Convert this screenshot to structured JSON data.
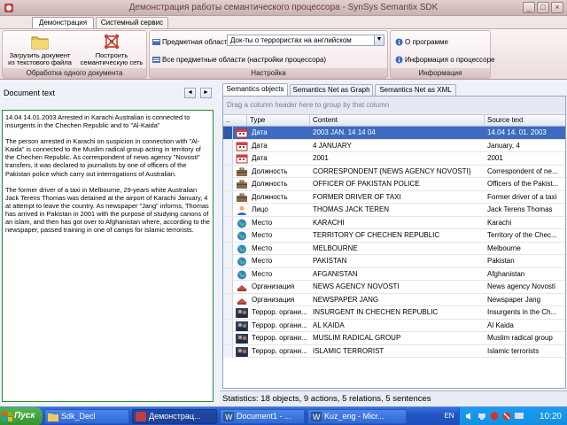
{
  "window": {
    "title": "Демонстрация работы семантического процессора - SynSys Semantix SDK"
  },
  "ribbon_tabs": [
    {
      "label": "Демонстрация",
      "active": true
    },
    {
      "label": "Системный сервис",
      "active": false
    }
  ],
  "ribbon": {
    "doc_group": {
      "caption": "Обработка одного документа",
      "load_btn_line1": "Загрузить документ",
      "load_btn_line2": "из текстового файла",
      "build_btn_line1": "Построить",
      "build_btn_line2": "семантическую сеть"
    },
    "settings_group": {
      "caption": "Настройка",
      "subject_label": "Предметная область",
      "subject_value": "Док-ты о террористах на английском",
      "all_subjects": "Все предметные области (настройки процессора)"
    },
    "info_group": {
      "caption": "Информация",
      "about": "О программе",
      "proc_info": "Информация о процессоре"
    }
  },
  "document": {
    "label": "Document text",
    "paragraphs": [
      "14.04 14.01.2003 Arrested in Karachi Australian is connected to insurgents in the Chechen Republic and to \"Al-Kaida\"",
      "The person arrested in Karachi on suspicion in connection with \"Al-Kaida\" is connected to the Muslim radical group acting in territory of the Chechen Republic.   As correspondent of news agency \"Novosti\" transfers, it was declared to journalists by one of officers of the Pakistan police which carry out interrogations of Australian.",
      "  The former driver of a taxi in Melbourne, 29-years white Australian Jack Terens Thomas was detained at the airport of Karachi January, 4 at attempt to leave the country. As newspaper \"Jang\" informs, Thomas has arrived in Pakistan in 2001 with the purpose of studying canons of an islam, and then has got over to Afghanistan where, according to the newspaper, passed training in one of camps for Islamic terrorists."
    ]
  },
  "content_tabs": [
    {
      "label": "Semantics objects",
      "active": true
    },
    {
      "label": "Semantics Net as Graph",
      "active": false
    },
    {
      "label": "Semantics Net as XML",
      "active": false
    }
  ],
  "grid": {
    "group_hint": "Drag a column header here to group by that column",
    "columns": {
      "marker": "..",
      "type": "Type",
      "content": "Content",
      "source": "Source text"
    },
    "rows": [
      {
        "icon": "calendar-icon",
        "type": "Дата",
        "content": "2003 JAN. 14 14 04",
        "source": "14.04 14. 01. 2003",
        "selected": true
      },
      {
        "icon": "calendar-icon",
        "type": "Дата",
        "content": "4 JANUARY",
        "source": "January, 4"
      },
      {
        "icon": "calendar-icon",
        "type": "Дата",
        "content": "2001",
        "source": "2001"
      },
      {
        "icon": "briefcase-icon",
        "type": "Должность",
        "content": "CORRESPONDENT {NEWS AGENCY NOVOSTI}",
        "source": "Correspondent of ne..."
      },
      {
        "icon": "briefcase-icon",
        "type": "Должность",
        "content": "OFFICER OF PAKISTAN POLICE",
        "source": "Officers of the Pakist..."
      },
      {
        "icon": "briefcase-icon",
        "type": "Должность",
        "content": "FORMER DRIVER OF TAXI",
        "source": "Former driver of a taxi"
      },
      {
        "icon": "person-icon",
        "type": "Лицо",
        "content": "THOMAS JACK TEREN",
        "source": "Jack Terens Thomas"
      },
      {
        "icon": "globe-icon",
        "type": "Место",
        "content": "KARACHI",
        "source": "Karachi"
      },
      {
        "icon": "globe-icon",
        "type": "Место",
        "content": "TERRITORY OF CHECHEN REPUBLIC",
        "source": "Territory of the Chec..."
      },
      {
        "icon": "globe-icon",
        "type": "Место",
        "content": "MELBOURNE",
        "source": "Melbourne"
      },
      {
        "icon": "globe-icon",
        "type": "Место",
        "content": "PAKISTAN",
        "source": "Pakistan"
      },
      {
        "icon": "globe-icon",
        "type": "Место",
        "content": "AFGANISTAN",
        "source": "Afghanistan"
      },
      {
        "icon": "organization-icon",
        "type": "Организация",
        "content": "NEWS AGENCY NOVOSTI",
        "source": "News agency Novosti"
      },
      {
        "icon": "organization-icon",
        "type": "Организация",
        "content": "NEWSPAPER JANG",
        "source": "Newspaper Jang"
      },
      {
        "icon": "terror-org-icon",
        "type": "Террор. органи...",
        "content": "INSURGENT IN CHECHEN REPUBLIC",
        "source": "Insurgents in the Ch..."
      },
      {
        "icon": "terror-org-icon",
        "type": "Террор. органи...",
        "content": "AL KAIDA",
        "source": "Al Kaida"
      },
      {
        "icon": "terror-org-icon",
        "type": "Террор. органи...",
        "content": "MUSLIM RADICAL GROUP",
        "source": "Muslim radical group"
      },
      {
        "icon": "terror-org-icon",
        "type": "Террор. органи...",
        "content": "ISLAMIC TERRORIST",
        "source": "Islamic terrorists"
      }
    ]
  },
  "status": "Statistics: 18 objects, 9 actions, 5 relations, 5 sentences",
  "taskbar": {
    "start": "Пуск",
    "tasks": [
      {
        "label": "Sdk_Decl",
        "active": false
      },
      {
        "label": "Демонстрац...",
        "active": true
      },
      {
        "label": "Document1 - ...",
        "active": false
      },
      {
        "label": "Kuz_eng - Micr...",
        "active": false
      }
    ],
    "lang": "EN",
    "clock": "10:20"
  },
  "colors": {
    "selection": "#3d6bc1",
    "doc_border": "#2f8a2f",
    "taskbar": "#2455c5",
    "ribbon_accent": "#c9b1b1"
  }
}
